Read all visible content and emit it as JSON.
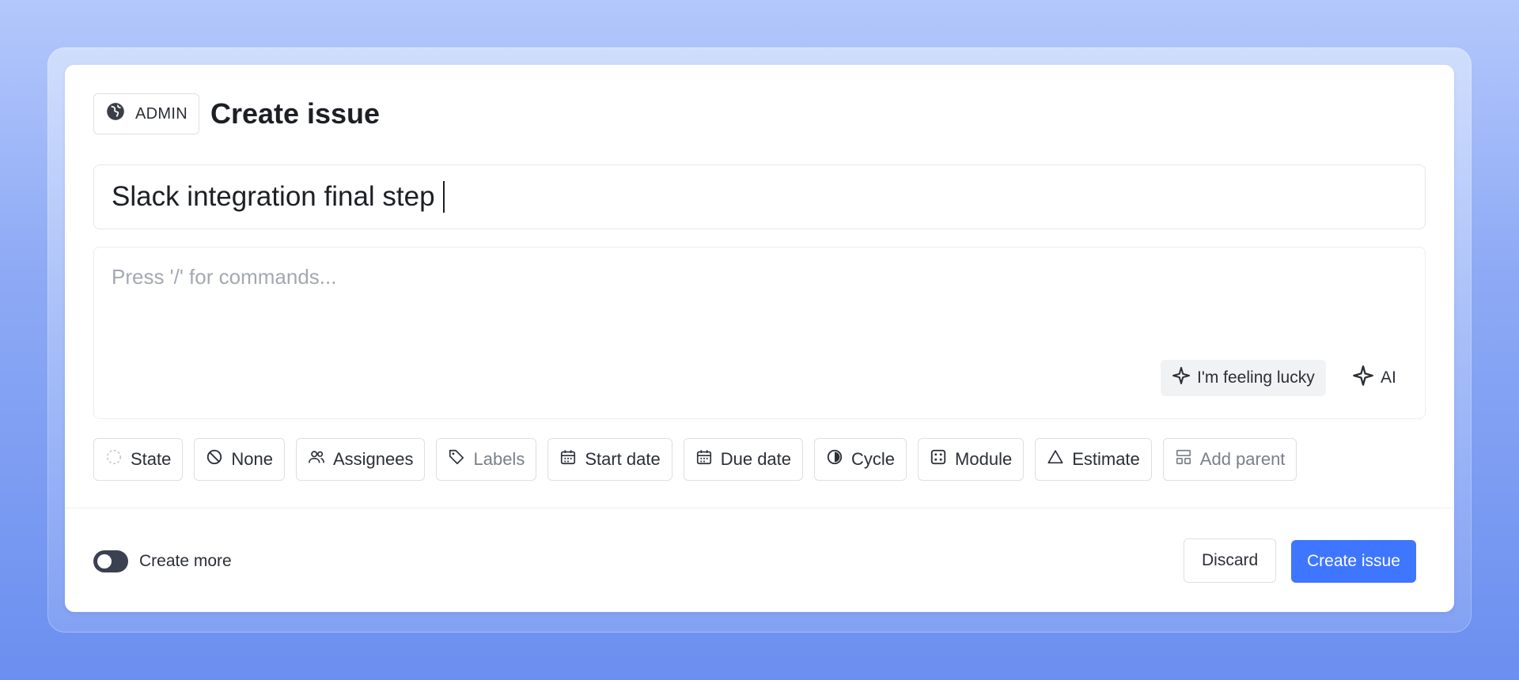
{
  "header": {
    "project_label": "ADMIN",
    "project_icon": "globe-icon",
    "title": "Create issue"
  },
  "title_input": {
    "value": "Slack integration final step"
  },
  "description": {
    "placeholder": "Press '/' for commands...",
    "lucky_label": "I'm feeling lucky",
    "ai_label": "AI"
  },
  "properties": [
    {
      "label": "State",
      "icon": "state-dashed-circle-icon"
    },
    {
      "label": "None",
      "icon": "priority-none-icon"
    },
    {
      "label": "Assignees",
      "icon": "users-icon"
    },
    {
      "label": "Labels",
      "icon": "tag-icon"
    },
    {
      "label": "Start date",
      "icon": "calendar-icon"
    },
    {
      "label": "Due date",
      "icon": "calendar-icon"
    },
    {
      "label": "Cycle",
      "icon": "contrast-icon"
    },
    {
      "label": "Module",
      "icon": "module-icon"
    },
    {
      "label": "Estimate",
      "icon": "triangle-icon"
    },
    {
      "label": "Add parent",
      "icon": "layout-icon"
    }
  ],
  "footer": {
    "create_more_label": "Create more",
    "create_more_enabled": false,
    "discard_label": "Discard",
    "submit_label": "Create issue"
  },
  "colors": {
    "primary": "#3f76ff",
    "toggle": "#3a4150"
  }
}
